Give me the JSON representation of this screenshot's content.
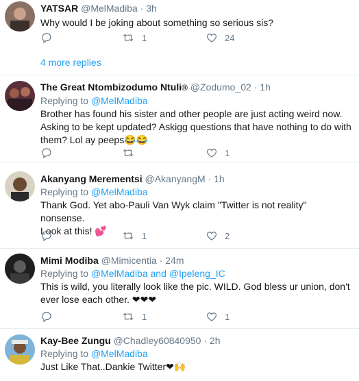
{
  "colors": {
    "link": "#1da1f2",
    "muted": "#657786",
    "text": "#14171a",
    "divider": "#e6ecf0",
    "heart": "#e0245e"
  },
  "icons": {
    "reply": "reply-icon",
    "retweet": "retweet-icon",
    "like": "heart-icon"
  },
  "thread_top": {
    "name": "YATSAR",
    "handle": "@MelMadiba",
    "dot": "·",
    "time": "3h",
    "text": "Why would I be joking about something so serious sis?",
    "retweets": "1",
    "likes": "24",
    "more_replies": "4 more replies"
  },
  "replies": [
    {
      "name": "The Great Ntombizodumo Ntuli",
      "badge": "®",
      "handle": "@Zodumo_02",
      "dot": "·",
      "time": "1h",
      "replying_prefix": "Replying to",
      "replying_to": "@MelMadiba",
      "text_line1": "Brother has found his sister and other people are just acting weird now.",
      "text_line2": "Asking to be kept updated? Askigg questions that have nothing to do with",
      "text_line3": "them? Lol ay peeps😂😂",
      "retweets": "",
      "likes": "1"
    },
    {
      "name": "Akanyang Merementsi",
      "handle": "@AkanyangM",
      "dot": "·",
      "time": "1h",
      "replying_prefix": "Replying to",
      "replying_to": "@MelMadiba",
      "text_line1": "Thank God. Yet abo-Pauli Van Wyk claim \"Twitter is not reality\" nonsense.",
      "text_line2": "Look at this! 💕",
      "retweets": "1",
      "likes": "2"
    },
    {
      "name": "Mimi Modiba",
      "handle": "@Mimicentia",
      "dot": "·",
      "time": "24m",
      "replying_prefix": "Replying to",
      "replying_to": "@MelMadiba and @Ipeleng_IC",
      "text_line1": "This is wild, you literally look like the pic. WILD. God bless ur union, don't",
      "text_line2": "ever lose each other. ❤❤❤",
      "retweets": "1",
      "likes": "1"
    },
    {
      "name": "Kay-Bee Zungu",
      "handle": "@Chadley60840950",
      "dot": "·",
      "time": "2h",
      "replying_prefix": "Replying to",
      "replying_to": "@MelMadiba",
      "text_line1": "Just Like That..Dankie Twitter❤🙌"
    }
  ]
}
